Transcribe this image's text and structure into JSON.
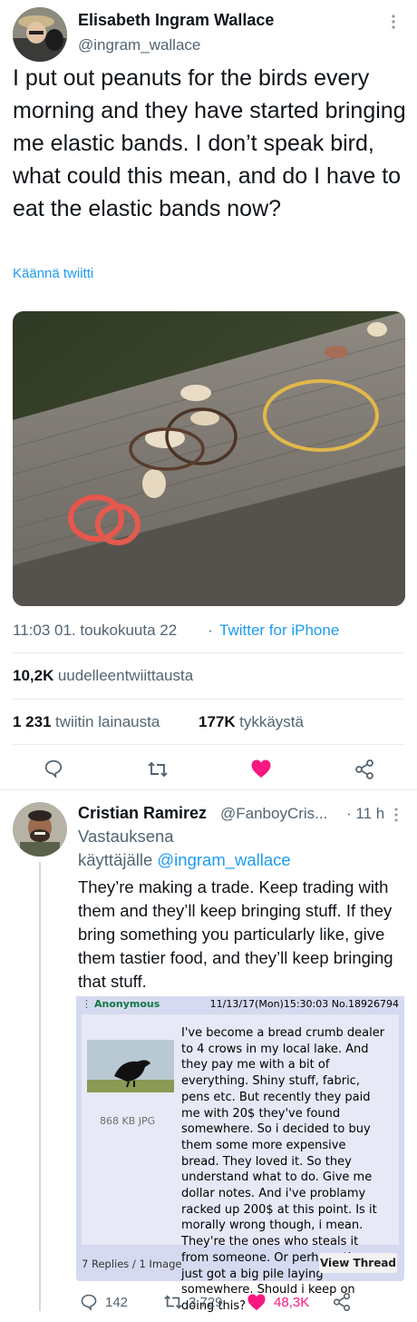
{
  "tweet": {
    "author_name": "Elisabeth Ingram Wallace",
    "author_handle": "@ingram_wallace",
    "text": "I put out peanuts for the birds every morning and they have started bringing me elastic bands. I don’t speak bird, what could this mean, and do I have to eat the elastic bands now?",
    "translate_label": "Käännä twiitti",
    "timestamp": "11:03 01. toukokuuta 22",
    "separator": "·",
    "source": "Twitter for iPhone",
    "retweets_count": "10,2K",
    "retweets_label": "uudelleentwiittausta",
    "quotes_count": "1 231",
    "quotes_label": "twiitin lainausta",
    "likes_count": "177K",
    "likes_label": "tykkäystä"
  },
  "reply": {
    "author_name": "Cristian Ramirez",
    "author_handle": "@FanboyCris...",
    "time": "· 11 h",
    "replying_prefix": "Vastauksena",
    "replying_to_prefix": "käyttäjälle",
    "replying_to_handle": "@ingram_wallace",
    "text": "They’re making a trade. Keep trading with them and they’ll keep bringing stuff. If they bring something you particularly like, give them tastier food, and they’ll keep bringing that stuff.",
    "replies": "142",
    "retweets": "3 729",
    "likes": "48,3K"
  },
  "chan_post": {
    "poster": "Anonymous",
    "datetime": "11/13/17(Mon)15:30:03 No.18926794",
    "file_info": "868 KB JPG",
    "text": "I've become a bread crumb dealer to 4 crows in my local lake. And they pay me with a bit of everything. Shiny stuff, fabric, pens etc. But recently they paid me with 20$ they've found somewhere. So i decided to buy them some more expensive bread. They loved it. So they understand what to do. Give me dollar notes. And i've problamy racked up 200$ at this point. Is it morally wrong though, i mean. They're the ones who steals it from someone. Or perhaps they just got a big pile laying somewhere. Should i keep on doing this?",
    "footer": "7 Replies / 1 Image",
    "view_thread_label": "View Thread"
  },
  "icons": [
    "more-icon",
    "reply-icon",
    "retweet-icon",
    "like-icon",
    "share-icon"
  ],
  "colors": {
    "link": "#1d9bf0",
    "like": "#f91880",
    "secondary": "#536471",
    "chan_bg": "#d6daf0",
    "chan_name": "#117743"
  }
}
